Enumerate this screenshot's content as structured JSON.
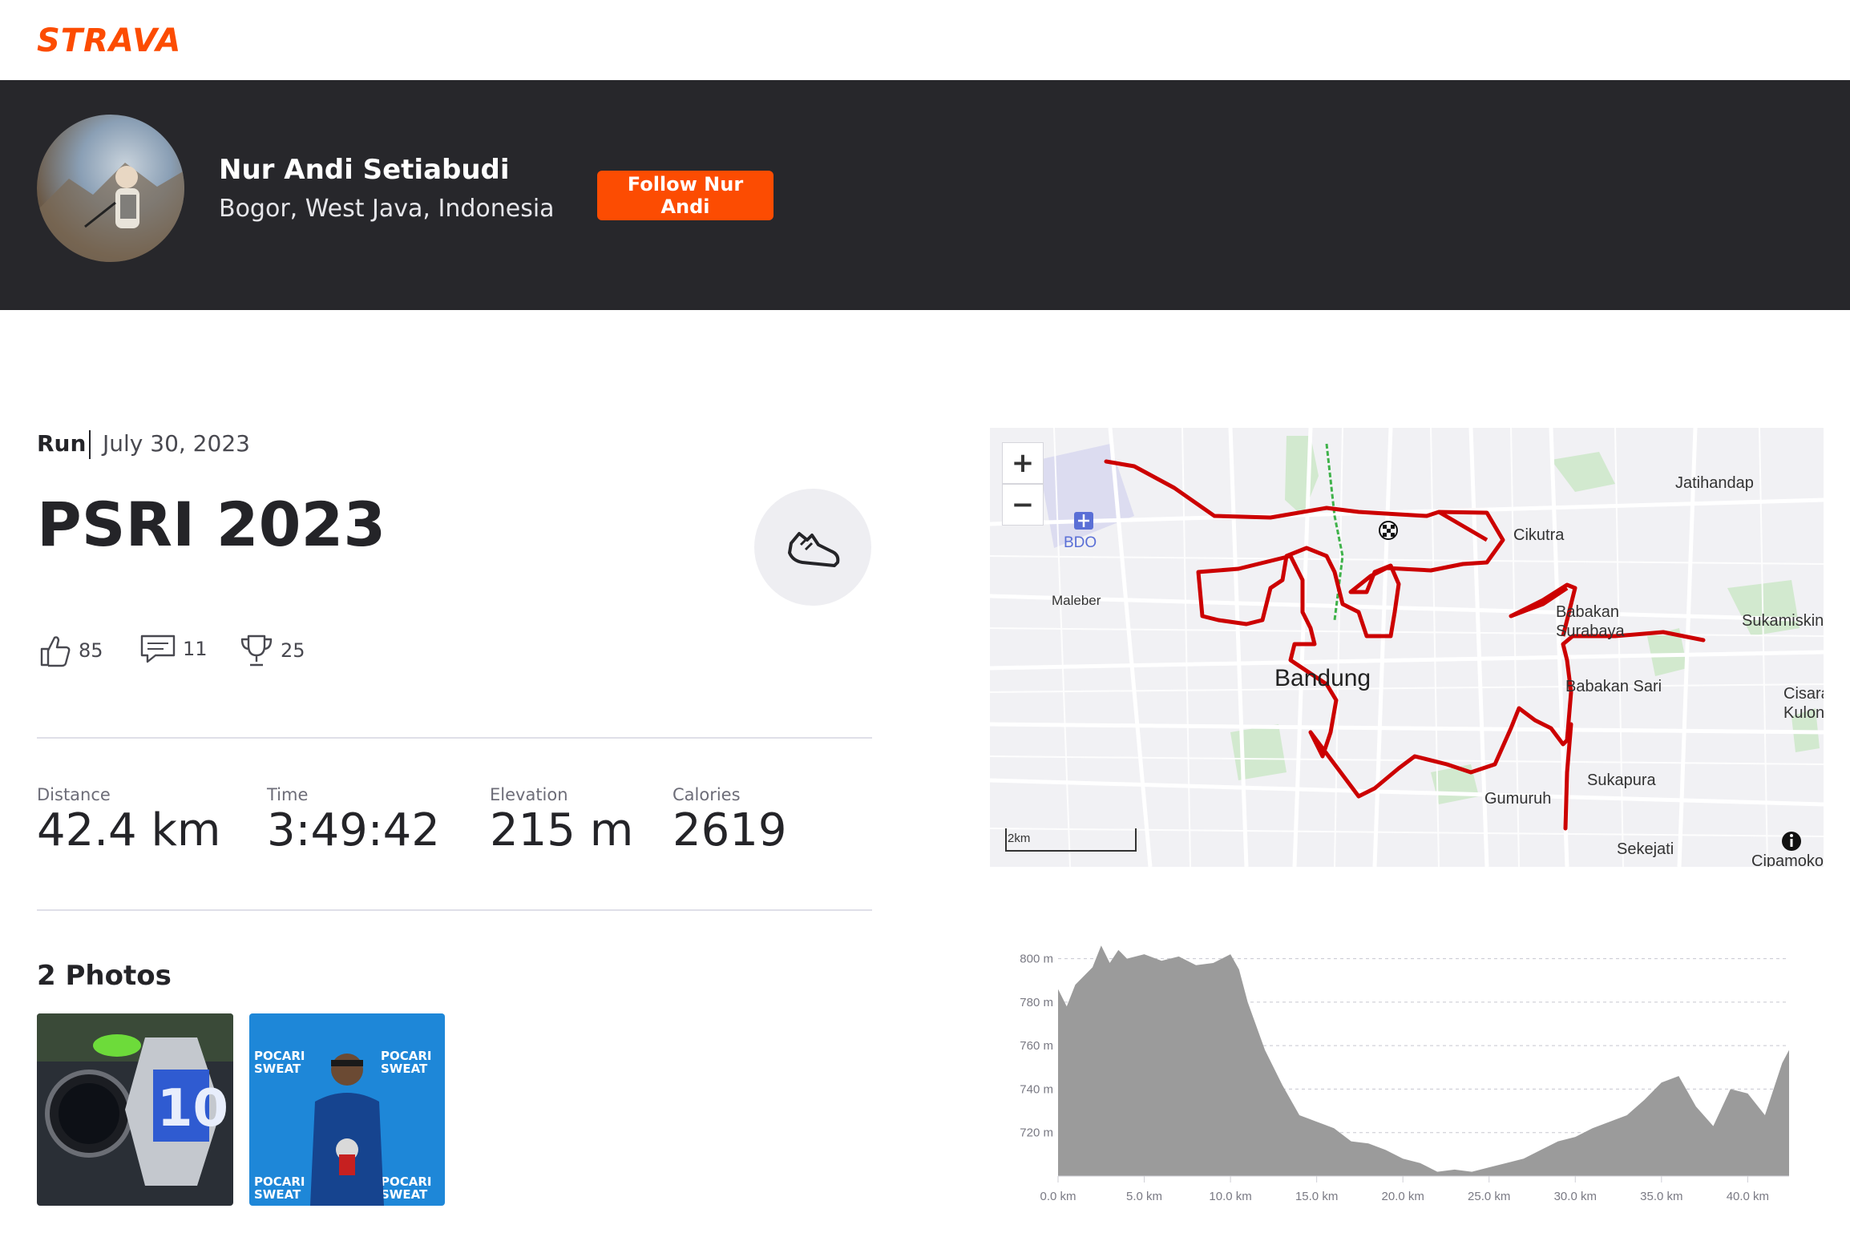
{
  "brand": {
    "logo_text": "STRAVA",
    "accent": "#fc4c02"
  },
  "athlete": {
    "name": "Nur Andi Setiabudi",
    "location": "Bogor, West Java, Indonesia",
    "follow_label": "Follow Nur Andi"
  },
  "activity": {
    "sport": "Run",
    "date": "July 30, 2023",
    "title": "PSRI 2023",
    "sport_icon": "running-shoe-icon",
    "kudos": "85",
    "comments": "11",
    "achievements": "25"
  },
  "stats": [
    {
      "label": "Distance",
      "value": "42.4 km"
    },
    {
      "label": "Time",
      "value": "3:49:42"
    },
    {
      "label": "Elevation",
      "value": "215 m"
    },
    {
      "label": "Calories",
      "value": "2619"
    }
  ],
  "photos": {
    "title": "2 Photos",
    "items": [
      {
        "alt": "medal-and-watch-photo"
      },
      {
        "alt": "runner-with-medal-photo"
      }
    ]
  },
  "map": {
    "zoom_in": "+",
    "zoom_out": "−",
    "scale": "2km",
    "airport_code": "BDO",
    "labels": [
      "Jatihandap",
      "Cikutra",
      "Maleber",
      "Babakan Surabaya",
      "Sukamiskin",
      "Bandung",
      "Babakan Sari",
      "Cisaranten Kulon",
      "Sukapura",
      "Gumuruh",
      "Sekejati",
      "Cipamokolan"
    ],
    "route_color": "#cc0000"
  },
  "elevation_chart": {
    "type": "area",
    "y_ticks": [
      "800 m",
      "780 m",
      "760 m",
      "740 m",
      "720 m"
    ],
    "x_ticks": [
      "0.0 km",
      "5.0 km",
      "10.0 km",
      "15.0 km",
      "20.0 km",
      "25.0 km",
      "30.0 km",
      "35.0 km",
      "40.0 km"
    ]
  },
  "chart_data": {
    "type": "area",
    "xlabel": "",
    "ylabel": "",
    "xlim": [
      0,
      42.4
    ],
    "ylim": [
      700,
      805
    ],
    "x": [
      0,
      0.5,
      1,
      2,
      2.5,
      3,
      3.5,
      4,
      5,
      6,
      7,
      8,
      9,
      10,
      10.5,
      11,
      12,
      13,
      14,
      15,
      16,
      17,
      18,
      19,
      20,
      21,
      22,
      23,
      24,
      25,
      26,
      27,
      28,
      29,
      30,
      31,
      32,
      33,
      34,
      35,
      36,
      37,
      38,
      39,
      40,
      41,
      42,
      42.4
    ],
    "values": [
      786,
      778,
      788,
      796,
      806,
      798,
      804,
      800,
      802,
      799,
      801,
      797,
      798,
      802,
      795,
      780,
      758,
      742,
      728,
      725,
      722,
      716,
      715,
      712,
      708,
      706,
      702,
      703,
      702,
      704,
      706,
      708,
      712,
      716,
      718,
      722,
      725,
      728,
      735,
      743,
      746,
      732,
      723,
      740,
      738,
      728,
      752,
      758
    ]
  }
}
